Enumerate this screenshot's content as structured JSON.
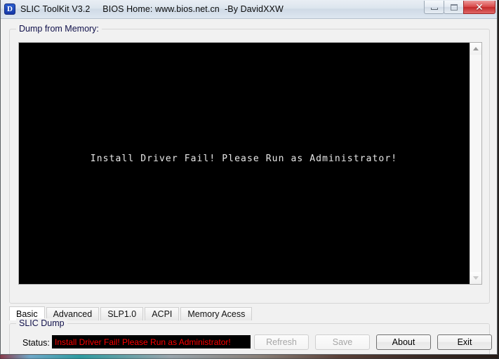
{
  "window": {
    "icon_name": "app-icon-slic",
    "title": "SLIC ToolKit V3.2     BIOS Home: www.bios.net.cn  -By DavidXXW",
    "minimize_label": "—",
    "maximize_label": "□",
    "close_label": "✕"
  },
  "dump_group": {
    "label": "Dump from Memory:",
    "content_text": "Install Driver Fail! Please Run as Administrator!",
    "scroll_up_label": "▲",
    "scroll_down_label": "▼"
  },
  "tabs": [
    {
      "label": "Basic",
      "active": true
    },
    {
      "label": "Advanced",
      "active": false
    },
    {
      "label": "SLP1.0",
      "active": false
    },
    {
      "label": "ACPI",
      "active": false
    },
    {
      "label": "Memory Acess",
      "active": false
    }
  ],
  "slic_group": {
    "label": "SLIC Dump",
    "status_label": "Status:",
    "status_text": "Install Driver Fail! Please Run as Administrator!",
    "status_text_color": "#ff0000",
    "status_background": "#000000"
  },
  "buttons": [
    {
      "label": "Refresh",
      "enabled": false
    },
    {
      "label": "Save",
      "enabled": false
    },
    {
      "label": "About",
      "enabled": true
    },
    {
      "label": "Exit",
      "enabled": true
    }
  ]
}
